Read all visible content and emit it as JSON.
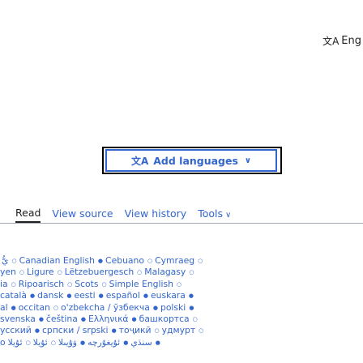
{
  "header": {
    "language_button_label": "Eng",
    "language_glyph": "文A"
  },
  "add_languages": {
    "glyph": "文A",
    "label": "Add languages",
    "chevron": "∨"
  },
  "tabs": [
    {
      "label": "Read"
    },
    {
      "label": "View source"
    },
    {
      "label": "View history"
    },
    {
      "label": "Tools"
    }
  ],
  "language_lines": [
    [
      {
        "t": "يُّ",
        "d": "○"
      },
      {
        "t": "Canadian English",
        "d": "●"
      },
      {
        "t": "Cebuano",
        "d": "○"
      },
      {
        "t": "Cymraeg",
        "d": "○"
      }
    ],
    [
      {
        "t": "yen",
        "d": "○"
      },
      {
        "t": "Ligure",
        "d": "○"
      },
      {
        "t": "Lëtzebuergesch",
        "d": "○"
      },
      {
        "t": "Malagasy",
        "d": "○"
      }
    ],
    [
      {
        "t": "ia",
        "d": "○"
      },
      {
        "t": "Ripoarisch",
        "d": "○"
      },
      {
        "t": "Scots",
        "d": "○"
      },
      {
        "t": "Simple English",
        "d": "○"
      }
    ],
    [
      {
        "t": "català",
        "d": "●"
      },
      {
        "t": "dansk",
        "d": "●"
      },
      {
        "t": "eesti",
        "d": "●"
      },
      {
        "t": "español",
        "d": "●"
      },
      {
        "t": "euskara",
        "d": "●"
      }
    ],
    [
      {
        "t": "al",
        "d": "●"
      },
      {
        "t": "occitan",
        "d": "○"
      },
      {
        "t": "o'zbekcha / ўзбекча",
        "d": "●"
      },
      {
        "t": "polski",
        "d": "●"
      }
    ],
    [
      {
        "t": "svenska",
        "d": "●"
      },
      {
        "t": "čeština",
        "d": "●"
      },
      {
        "t": "Ελληνικά",
        "d": "●"
      },
      {
        "t": "башкортса",
        "d": "○"
      }
    ],
    [
      {
        "t": "ycский",
        "d": "●"
      },
      {
        "t": "српски / srpski",
        "d": "●"
      },
      {
        "t": "тоҷикӣ",
        "d": "○"
      },
      {
        "t": "удмурт",
        "d": "○"
      }
    ],
    [
      {
        "t": "o",
        "d": ""
      },
      {
        "t": "سنڌي",
        "d": "●"
      },
      {
        "t": "ئۇيغۇرچە",
        "d": "●"
      },
      {
        "t": "ۋۇيىلا",
        "d": "○"
      },
      {
        "t": "ئۇيلا",
        "d": "○"
      },
      {
        "t": "ئۇيلا",
        "d": "●"
      }
    ]
  ]
}
